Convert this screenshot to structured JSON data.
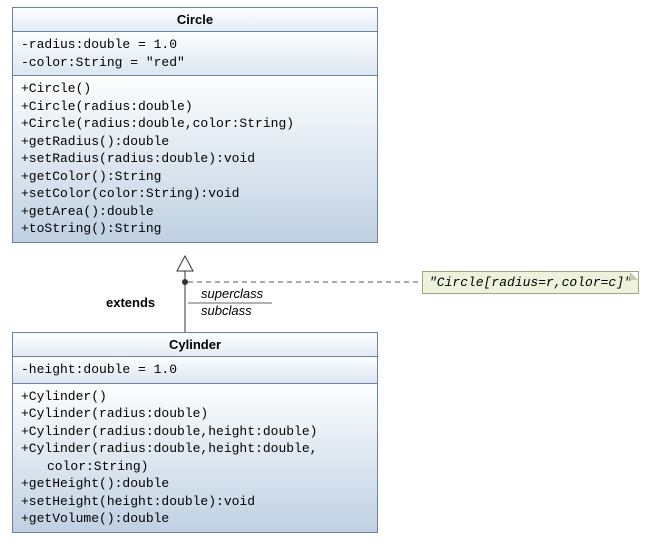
{
  "circle": {
    "name": "Circle",
    "attrs": [
      "-radius:double = 1.0",
      "-color:String = \"red\""
    ],
    "methods": [
      "+Circle()",
      "+Circle(radius:double)",
      "+Circle(radius:double,color:String)",
      "+getRadius():double",
      "+setRadius(radius:double):void",
      "+getColor():String",
      "+setColor(color:String):void",
      "+getArea():double",
      "+toString():String"
    ]
  },
  "cylinder": {
    "name": "Cylinder",
    "attrs": [
      "-height:double = 1.0"
    ],
    "methods": [
      "+Cylinder()",
      "+Cylinder(radius:double)",
      "+Cylinder(radius:double,height:double)",
      "+Cylinder(radius:double,height:double,",
      "color:String)",
      "+getHeight():double",
      "+setHeight(height:double):void",
      "+getVolume():double"
    ],
    "indent_rows": [
      4
    ]
  },
  "relation": {
    "extends": "extends",
    "superclass": "superclass",
    "subclass": "subclass"
  },
  "note": {
    "text": "\"Circle[radius=r,color=c]\""
  }
}
